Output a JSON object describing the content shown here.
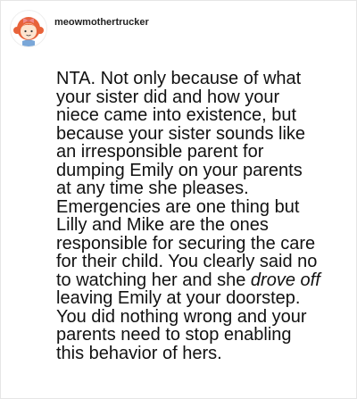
{
  "post": {
    "username": "meowmothertrucker",
    "avatar_icon": "cartoon-girl-avatar-icon",
    "body_lines": [
      {
        "text": "NTA. Not only because of what"
      },
      {
        "text": "your sister did and how your"
      },
      {
        "text": "niece came into existence, but"
      },
      {
        "text": "because your sister sounds like"
      },
      {
        "text": "an irresponsible parent for"
      },
      {
        "text": "dumping Emily on your parents"
      },
      {
        "text": "at any time she pleases."
      },
      {
        "text": "Emergencies are one thing but"
      },
      {
        "text": "Lilly and Mike are the ones"
      },
      {
        "text": "responsible for securing the care"
      },
      {
        "text": "for their child. You clearly said no"
      },
      {
        "pre": "to watching her and she ",
        "em": "drove off"
      },
      {
        "text": "leaving Emily at your doorstep."
      },
      {
        "text": "You did nothing wrong and your"
      },
      {
        "text": "parents need to stop enabling"
      },
      {
        "text": "this behavior of hers."
      }
    ]
  },
  "colors": {
    "text": "#111111",
    "username": "#222222",
    "border": "#e6e6e6",
    "avatar_hair": "#e8633a",
    "avatar_bow": "#f08a8a"
  }
}
